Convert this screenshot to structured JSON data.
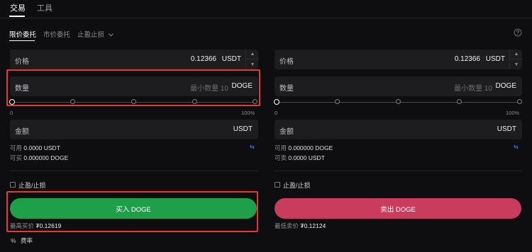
{
  "top_tabs": {
    "trade": "交易",
    "tools": "工具"
  },
  "order_types": {
    "limit": "限价委托",
    "market": "市价委托",
    "tp_sl": "止盈止损",
    "dropdown_icon": "chevron-down-icon",
    "help_icon": "question-circle-icon"
  },
  "buy": {
    "price_label": "价格",
    "price_value": "0.12366",
    "price_unit": "USDT",
    "qty_label": "数量",
    "qty_placeholder": "最小数量 10",
    "qty_unit": "DOGE",
    "slider_min": "0",
    "slider_max": "100%",
    "amount_label": "金额",
    "amount_unit": "USDT",
    "available_label": "可用",
    "available_value": "0.0000 USDT",
    "can_buy_label": "可买",
    "can_buy_value": "0.000000 DOGE",
    "tp_sl_label": "止盈/止损",
    "button_label": "买入 DOGE",
    "best_label": "最高买价",
    "best_value": "₮0.12619"
  },
  "sell": {
    "price_label": "价格",
    "price_value": "0.12366",
    "price_unit": "USDT",
    "qty_label": "数量",
    "qty_placeholder": "最小数量 10",
    "qty_unit": "DOGE",
    "slider_min": "0",
    "slider_max": "100%",
    "amount_label": "金额",
    "amount_unit": "USDT",
    "available_label": "可用",
    "available_value": "0.000000 DOGE",
    "can_sell_label": "可卖",
    "can_sell_value": "0.0000 USDT",
    "tp_sl_label": "止盈/止损",
    "button_label": "卖出 DOGE",
    "best_label": "最低卖价",
    "best_value": "₮0.12124"
  },
  "fee": {
    "icon": "%",
    "label": "费率"
  },
  "colors": {
    "background": "#0e0e10",
    "input_bg": "#1d1d20",
    "buy": "#1f9f4a",
    "sell": "#c93c5e",
    "highlight": "#e23b33",
    "transfer": "#4e8cf2"
  }
}
